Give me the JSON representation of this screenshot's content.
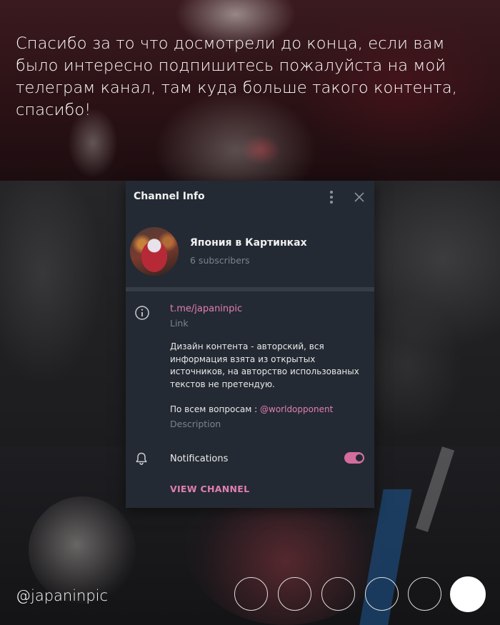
{
  "caption": {
    "text": "Спасибо за то что досмотрели до конца, если вам было интересно подпишитесь пожалуйста на мой телеграм канал, там куда больше такого контента, спасибо!"
  },
  "dialog": {
    "title": "Channel Info",
    "channel_name": "Япония в Картинках",
    "subscribers": "6 subscribers",
    "link_value": "t.me/japaninpic",
    "link_label": "Link",
    "description_text": "Дизайн контента - авторский, вся информация взята из открытых источников, на авторство использованых текстов не претендую.",
    "contact_prefix": "По всем вопросам :",
    "contact_mention": "@worldopponent",
    "description_label": "Description",
    "notifications_label": "Notifications",
    "notifications_enabled": true,
    "view_channel_label": "VIEW CHANNEL",
    "accent_color": "#e07fb4"
  },
  "footer": {
    "handle": "@japaninpic",
    "pager": {
      "total": 6,
      "active_index": 5
    }
  }
}
